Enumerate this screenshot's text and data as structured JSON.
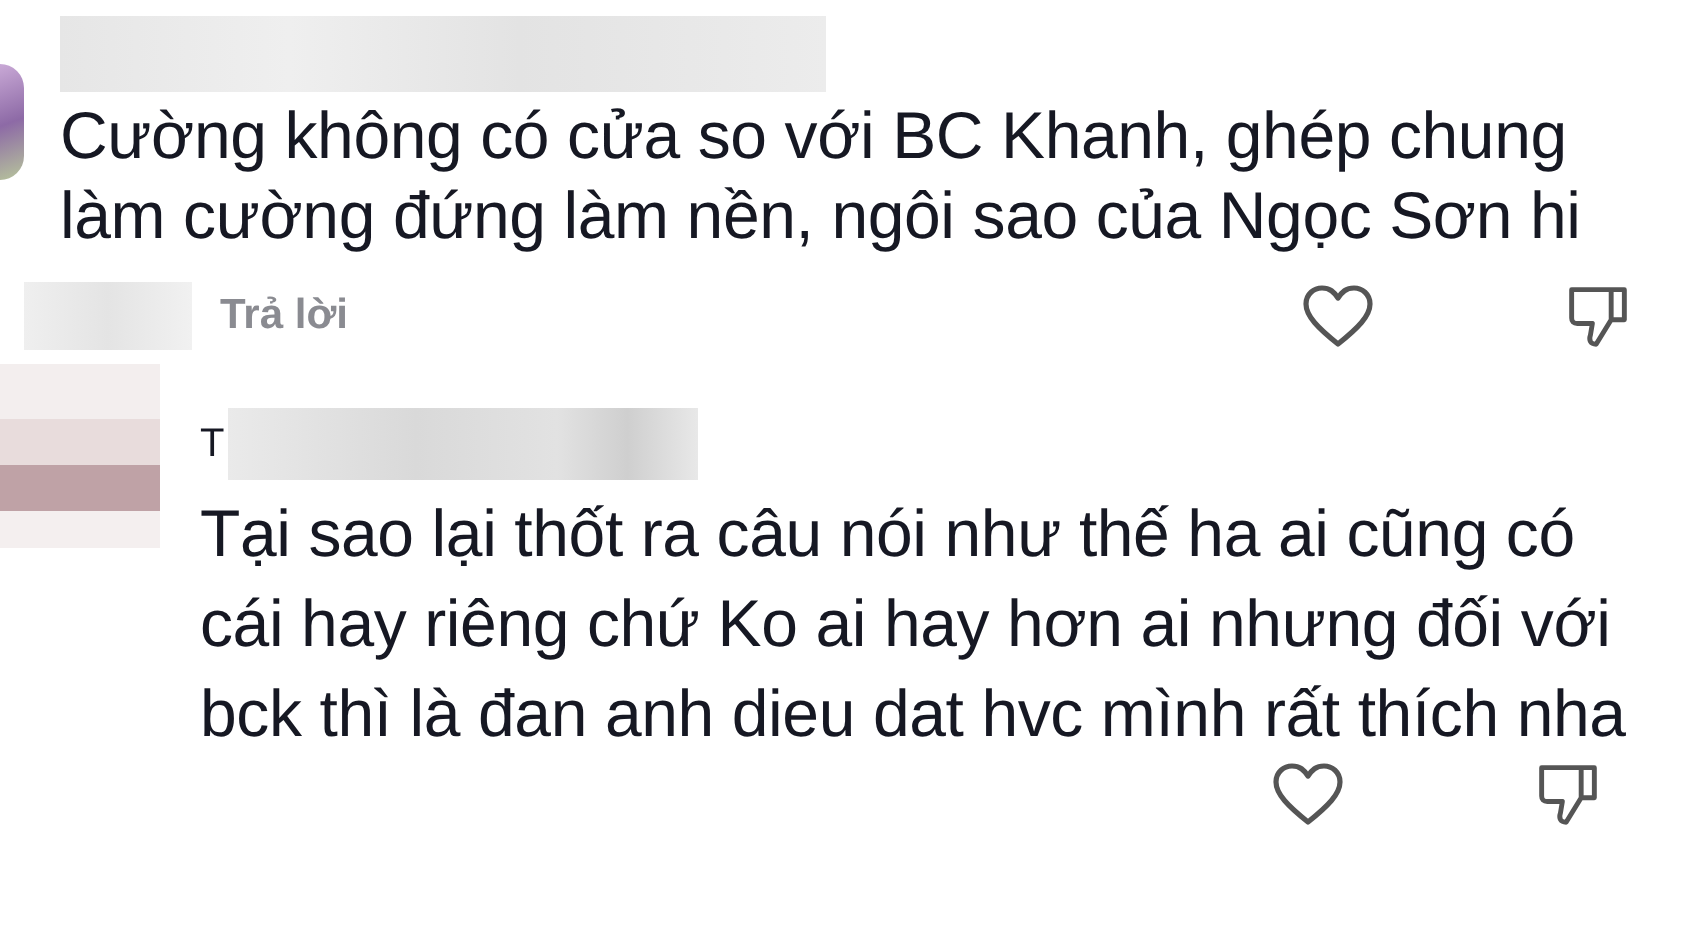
{
  "comments": [
    {
      "text": "Cường không có cửa so với BC Khanh, ghép chung làm cường đứng làm nền, ngôi sao của Ngọc Sơn hi",
      "reply_label": "Trả lời",
      "liked": false,
      "children": [
        {
          "name": "T",
          "text": "Tại sao lại thốt ra câu nói như thế ha ai cũng có cái hay riêng chứ Ko ai hay hơn ai nhưng đối với bck thì là đan anh dieu dat hvc mình rất thích nha",
          "liked": false
        }
      ]
    }
  ]
}
